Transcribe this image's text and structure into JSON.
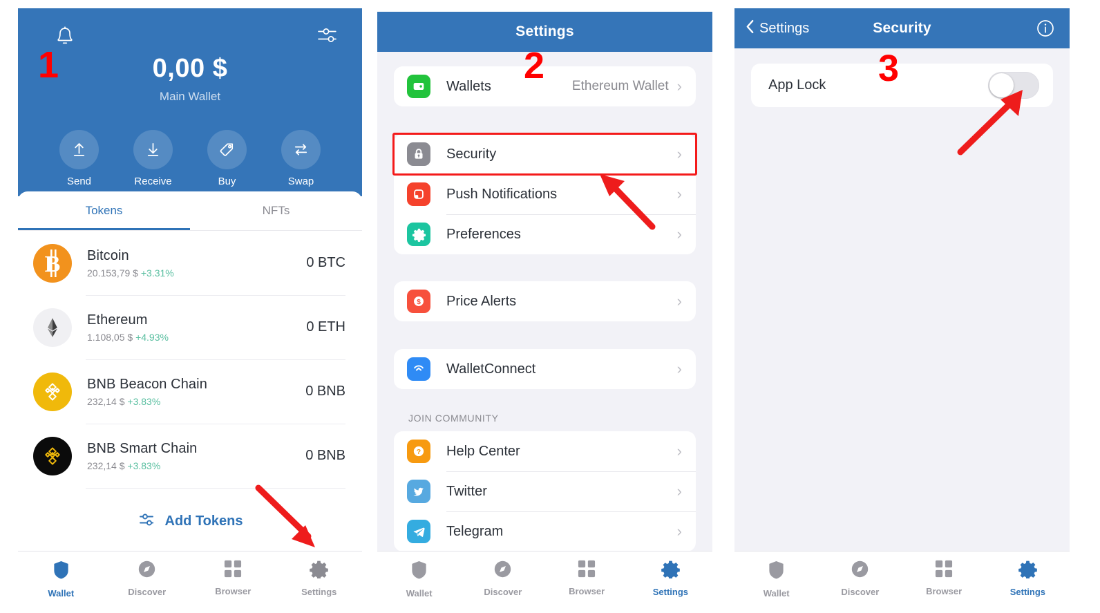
{
  "colors": {
    "brand_blue": "#3575b8",
    "accent_blue": "#2f73b7",
    "annotation_red": "#ff0000",
    "green_pct": "#59bfa0"
  },
  "steps": {
    "one": "1",
    "two": "2",
    "three": "3"
  },
  "panel1": {
    "header": {
      "bell_icon": "bell-icon",
      "sliders_icon": "sliders-icon",
      "balance": "0,00 $",
      "wallet_name": "Main Wallet"
    },
    "actions": [
      {
        "label": "Send",
        "icon": "upload-arrow-icon"
      },
      {
        "label": "Receive",
        "icon": "download-arrow-icon"
      },
      {
        "label": "Buy",
        "icon": "price-tag-icon"
      },
      {
        "label": "Swap",
        "icon": "swap-arrows-icon"
      }
    ],
    "tabs": [
      {
        "label": "Tokens",
        "active": true
      },
      {
        "label": "NFTs",
        "active": false
      }
    ],
    "tokens": [
      {
        "name": "Bitcoin",
        "price": "20.153,79 $",
        "change": "+3.31%",
        "amount": "0 BTC",
        "icon": "bitcoin-icon"
      },
      {
        "name": "Ethereum",
        "price": "1.108,05 $",
        "change": "+4.93%",
        "amount": "0 ETH",
        "icon": "ethereum-icon"
      },
      {
        "name": "BNB Beacon Chain",
        "price": "232,14 $",
        "change": "+3.83%",
        "amount": "0 BNB",
        "icon": "bnb-beacon-icon"
      },
      {
        "name": "BNB Smart Chain",
        "price": "232,14 $",
        "change": "+3.83%",
        "amount": "0 BNB",
        "icon": "bnb-smart-icon"
      }
    ],
    "add_tokens_label": "Add Tokens",
    "tabbar": [
      {
        "label": "Wallet",
        "icon": "shield-icon",
        "selected": true
      },
      {
        "label": "Discover",
        "icon": "compass-icon",
        "selected": false
      },
      {
        "label": "Browser",
        "icon": "grid-icon",
        "selected": false
      },
      {
        "label": "Settings",
        "icon": "gear-icon",
        "selected": false
      }
    ]
  },
  "panel2": {
    "navbar": {
      "title": "Settings"
    },
    "group1": [
      {
        "label": "Wallets",
        "value": "Ethereum Wallet",
        "icon": "wallet-icon"
      }
    ],
    "group2": [
      {
        "label": "Security",
        "value": "",
        "icon": "lock-icon",
        "highlighted": true
      },
      {
        "label": "Push Notifications",
        "value": "",
        "icon": "notification-icon",
        "highlighted": false
      },
      {
        "label": "Preferences",
        "value": "",
        "icon": "gear-icon",
        "highlighted": false
      }
    ],
    "group3": [
      {
        "label": "Price Alerts",
        "value": "",
        "icon": "dollar-badge-icon"
      }
    ],
    "group4": [
      {
        "label": "WalletConnect",
        "value": "",
        "icon": "walletconnect-icon"
      }
    ],
    "community_header": "JOIN COMMUNITY",
    "group5": [
      {
        "label": "Help Center",
        "value": "",
        "icon": "question-mark-icon"
      },
      {
        "label": "Twitter",
        "value": "",
        "icon": "twitter-icon"
      },
      {
        "label": "Telegram",
        "value": "",
        "icon": "telegram-icon"
      }
    ],
    "tabbar": [
      {
        "label": "Wallet",
        "icon": "shield-icon",
        "selected": false
      },
      {
        "label": "Discover",
        "icon": "compass-icon",
        "selected": false
      },
      {
        "label": "Browser",
        "icon": "grid-icon",
        "selected": false
      },
      {
        "label": "Settings",
        "icon": "gear-icon",
        "selected": true
      }
    ]
  },
  "panel3": {
    "navbar": {
      "back_label": "Settings",
      "back_icon": "chevron-left-icon",
      "title": "Security",
      "info_icon": "info-circle-icon"
    },
    "rows": [
      {
        "label": "App Lock",
        "toggle": "off"
      }
    ],
    "tabbar": [
      {
        "label": "Wallet",
        "icon": "shield-icon",
        "selected": false
      },
      {
        "label": "Discover",
        "icon": "compass-icon",
        "selected": false
      },
      {
        "label": "Browser",
        "icon": "grid-icon",
        "selected": false
      },
      {
        "label": "Settings",
        "icon": "gear-icon",
        "selected": true
      }
    ]
  }
}
